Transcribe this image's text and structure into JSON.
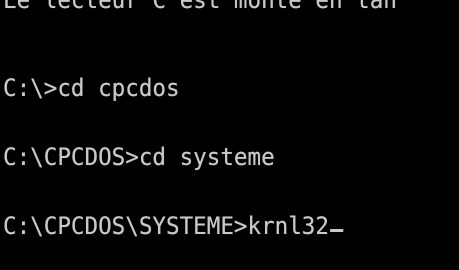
{
  "console": {
    "lines": [
      "Le lecteur C est monte en tan",
      "C:\\>cd cpcdos",
      "C:\\CPCDOS>cd systeme",
      "C:\\CPCDOS\\SYSTEME>krnl32"
    ],
    "text_color": "#c8c8c8",
    "background_color": "#000000"
  }
}
